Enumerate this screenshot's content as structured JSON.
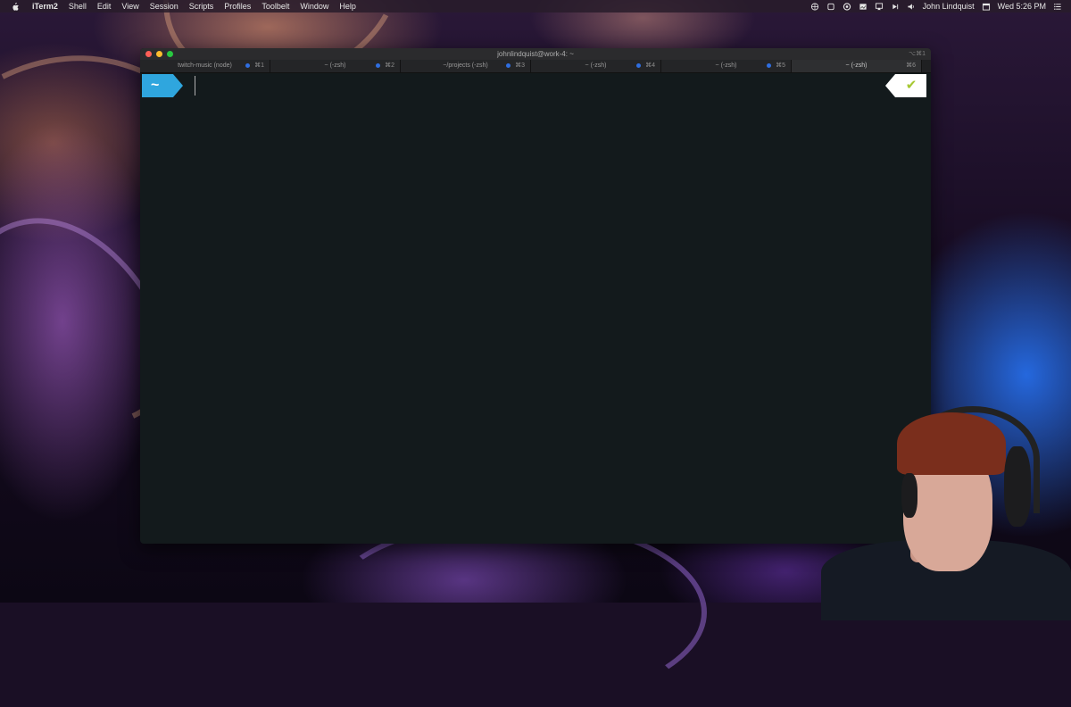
{
  "menubar": {
    "apple_icon": "apple-logo-icon",
    "app_name": "iTerm2",
    "menus": [
      "Shell",
      "Edit",
      "View",
      "Session",
      "Scripts",
      "Profiles",
      "Toolbelt",
      "Window",
      "Help"
    ],
    "status_icons": [
      "globe-icon",
      "square-icon",
      "creative-cloud-icon",
      "screen-icon",
      "airplay-icon",
      "play-icon",
      "volume-icon"
    ],
    "user_name": "John Lindquist",
    "datetime": "Wed 5:26 PM",
    "list_icon": "menu-list-icon"
  },
  "window": {
    "title": "johnlindquist@work-4: ~",
    "title_shortcut": "⌥⌘1",
    "tabs": [
      {
        "label": "twitch-music (node)",
        "key": "⌘1",
        "dot": true,
        "active": false
      },
      {
        "label": "~ (-zsh)",
        "key": "⌘2",
        "dot": true,
        "active": false
      },
      {
        "label": "~/projects (-zsh)",
        "key": "⌘3",
        "dot": true,
        "active": false
      },
      {
        "label": "~ (-zsh)",
        "key": "⌘4",
        "dot": true,
        "active": false
      },
      {
        "label": "~ (-zsh)",
        "key": "⌘5",
        "dot": true,
        "active": false
      },
      {
        "label": "~ (-zsh)",
        "key": "⌘6",
        "dot": false,
        "active": true
      }
    ]
  },
  "terminal": {
    "prompt_symbol": "~",
    "status_symbol": "✔",
    "colors": {
      "prompt_bg": "#2fa6de",
      "status_ok": "#a6c832",
      "terminal_bg": "#131a1c"
    }
  }
}
